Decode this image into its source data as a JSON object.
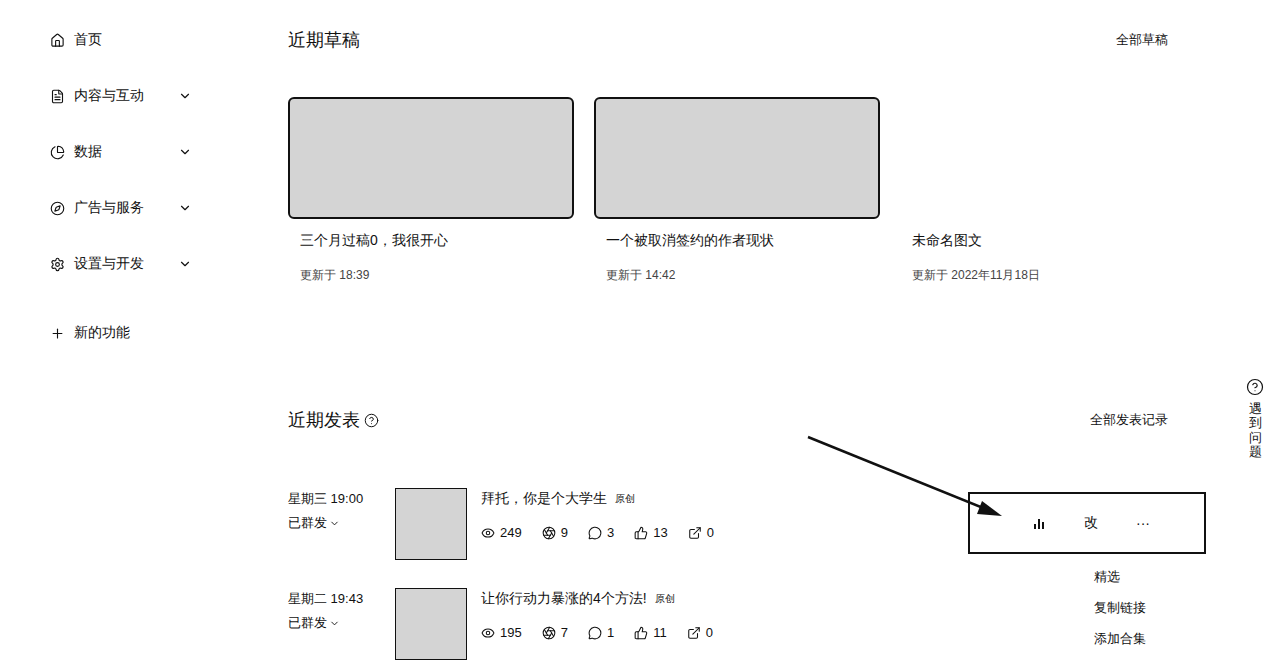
{
  "sidebar": {
    "items": [
      {
        "label": "首页",
        "kind": "nav",
        "expandable": false,
        "expanded": false
      },
      {
        "label": "内容与互动",
        "kind": "nav",
        "expandable": true,
        "expanded": false
      },
      {
        "label": "数据",
        "kind": "nav",
        "expandable": true,
        "expanded": false
      },
      {
        "label": "广告与服务",
        "kind": "nav",
        "expandable": true,
        "expanded": false
      },
      {
        "label": "设置与开发",
        "kind": "nav",
        "expandable": true,
        "expanded": false
      },
      {
        "label": "新的功能",
        "kind": "add",
        "expandable": false,
        "expanded": false
      }
    ]
  },
  "drafts": {
    "title": "近期草稿",
    "link": "全部草稿",
    "cards": [
      {
        "title": "三个月过稿0，我很开心",
        "updated": "更新于 18:39",
        "has_cover": true
      },
      {
        "title": "一个被取消签约的作者现状",
        "updated": "更新于 14:42",
        "has_cover": true
      },
      {
        "title": "未命名图文",
        "updated": "更新于 2022年11月18日",
        "has_cover": false
      }
    ]
  },
  "recent": {
    "title": "近期发表",
    "link": "全部发表记录",
    "posts": [
      {
        "time": "星期三 19:00",
        "status": "已群发",
        "title": "拜托，你是个大学生",
        "badge": "原创",
        "hovered": true,
        "stats": [
          {
            "kind": "views",
            "value": "249"
          },
          {
            "kind": "recommends",
            "value": "9"
          },
          {
            "kind": "comments",
            "value": "3"
          },
          {
            "kind": "likes",
            "value": "13"
          },
          {
            "kind": "shares",
            "value": "0"
          }
        ],
        "actions": [
          "改",
          "···"
        ],
        "menu_open": true,
        "menu": [
          "精选",
          "复制链接",
          "添加合集"
        ]
      },
      {
        "time": "星期二 19:43",
        "status": "已群发",
        "title": "让你行动力暴涨的4个方法!",
        "badge": "原创",
        "hovered": false,
        "stats": [
          {
            "kind": "views",
            "value": "195"
          },
          {
            "kind": "recommends",
            "value": "7"
          },
          {
            "kind": "comments",
            "value": "1"
          },
          {
            "kind": "likes",
            "value": "11"
          },
          {
            "kind": "shares",
            "value": "0"
          }
        ],
        "actions": [],
        "menu_open": false,
        "menu": []
      }
    ]
  },
  "help": {
    "label": "遇到问题"
  },
  "annotation": {
    "arrow": true,
    "box_around_actions": true
  }
}
